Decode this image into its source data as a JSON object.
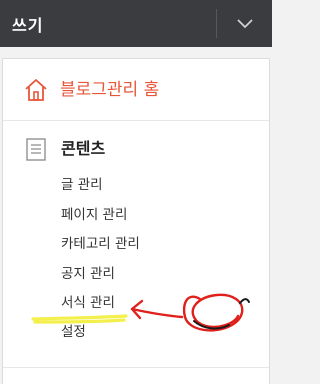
{
  "header": {
    "write_label": "쓰기",
    "dropdown_icon": "chevron-down-icon"
  },
  "sidebar": {
    "home": {
      "icon": "home-icon",
      "label": "블로그관리 홈",
      "color": "#e8563a"
    },
    "contents": {
      "icon": "document-icon",
      "title": "콘텐츠",
      "items": [
        {
          "label": "글 관리"
        },
        {
          "label": "페이지 관리"
        },
        {
          "label": "카테고리 관리"
        },
        {
          "label": "공지 관리"
        },
        {
          "label": "서식 관리"
        },
        {
          "label": "설정"
        }
      ]
    }
  },
  "colors": {
    "topbar": "#3a3c40",
    "accent": "#e8563a",
    "annotation_red": "#e0201b",
    "annotation_yellow": "#f2ee3a"
  }
}
